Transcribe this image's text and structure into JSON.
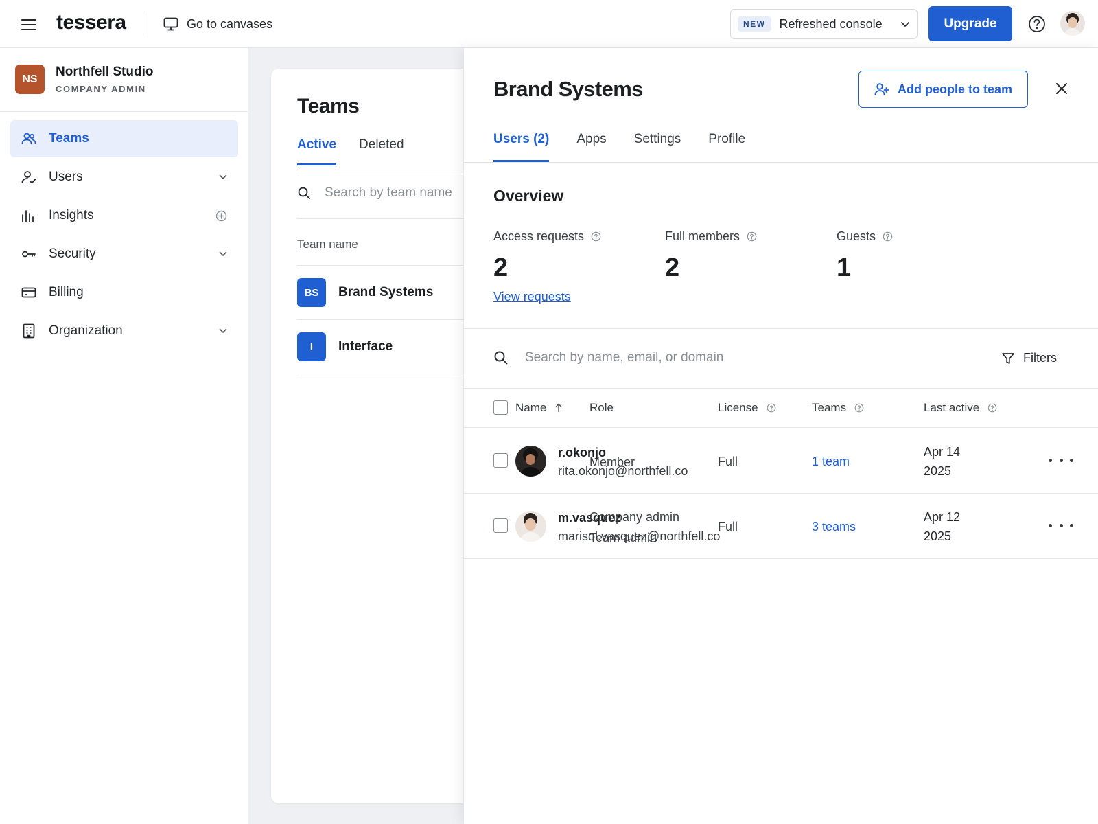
{
  "topbar": {
    "logo": "tessera",
    "goto_label": "Go to canvases",
    "new_badge": "NEW",
    "console_label": "Refreshed console",
    "upgrade_label": "Upgrade"
  },
  "org": {
    "initials": "NS",
    "name": "Northfell Studio",
    "role": "COMPANY ADMIN"
  },
  "sidebar": {
    "items": [
      {
        "label": "Teams"
      },
      {
        "label": "Users"
      },
      {
        "label": "Insights"
      },
      {
        "label": "Security"
      },
      {
        "label": "Billing"
      },
      {
        "label": "Organization"
      }
    ]
  },
  "teams": {
    "title": "Teams",
    "tabs": [
      "Active",
      "Deleted"
    ],
    "search_placeholder": "Search by team name",
    "column": "Team name",
    "rows": [
      {
        "initials": "BS",
        "name": "Brand Systems"
      },
      {
        "initials": "I",
        "name": "Interface"
      }
    ]
  },
  "panel": {
    "title": "Brand Systems",
    "add_people_label": "Add people to team",
    "tabs": [
      "Users (2)",
      "Apps",
      "Settings",
      "Profile"
    ],
    "overview_title": "Overview",
    "stats": [
      {
        "label": "Access requests",
        "value": "2"
      },
      {
        "label": "Full members",
        "value": "2"
      },
      {
        "label": "Guests",
        "value": "1"
      }
    ],
    "view_requests": "View requests",
    "search_placeholder": "Search by name, email, or domain",
    "filters_label": "Filters",
    "columns": {
      "name": "Name",
      "role": "Role",
      "license": "License",
      "teams": "Teams",
      "last_active": "Last active"
    },
    "users": [
      {
        "username": "r.okonjo",
        "email": "rita.okonjo@northfell.co",
        "role_line1": "Member",
        "role_line2": "",
        "license": "Full",
        "teams": "1 team",
        "last_active_date": "Apr 14",
        "last_active_year": "2025"
      },
      {
        "username": "m.vasquez",
        "email": "marisol.vasquez@northfell.co",
        "role_line1": "Company admin",
        "role_line2": "Team admin",
        "license": "Full",
        "teams": "3 teams",
        "last_active_date": "Apr 12",
        "last_active_year": "2025"
      }
    ]
  }
}
